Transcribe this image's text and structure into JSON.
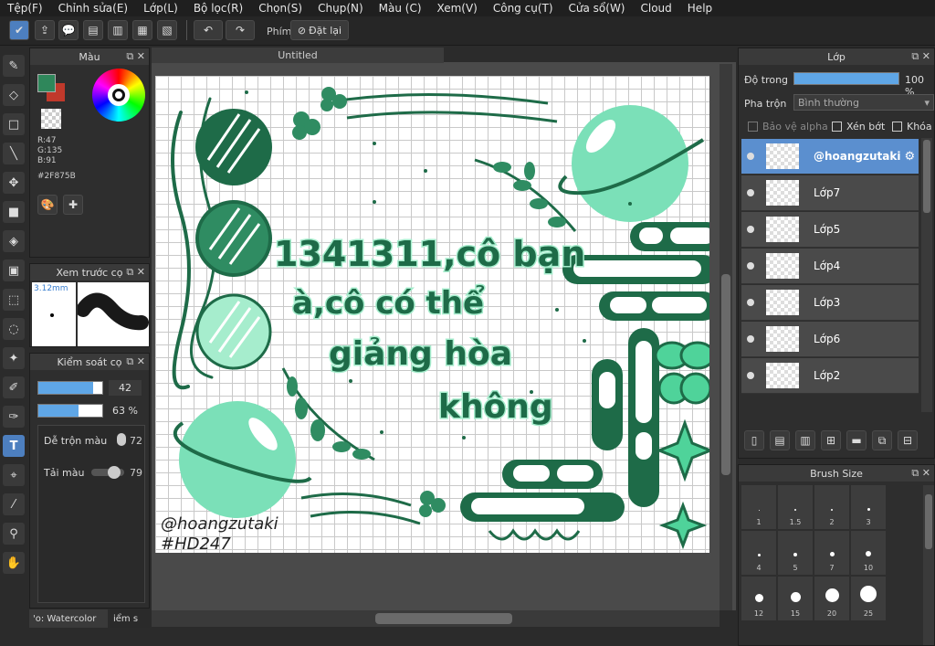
{
  "menu": [
    "Tệp(F)",
    "Chỉnh sửa(E)",
    "Lớp(L)",
    "Bộ lọc(R)",
    "Chọn(S)",
    "Chụp(N)",
    "Màu (C)",
    "Xem(V)",
    "Công cụ(T)",
    "Cửa sổ(W)",
    "Cloud",
    "Help"
  ],
  "toolbar": {
    "shortcut_label": "Phím",
    "reset_label": "Đặt lại"
  },
  "document": {
    "tab_title": "Untitled"
  },
  "color_panel": {
    "title": "Màu",
    "r": "R:47",
    "g": "G:135",
    "b": "B:91",
    "hex": "#2F875B",
    "primary_color": "#2F875B",
    "secondary_color": "#c0392b"
  },
  "brush_preview": {
    "title": "Xem trước cọ",
    "size": "3.12mm"
  },
  "brush_control": {
    "title": "Kiểm soát cọ",
    "size_value": "42",
    "opacity_value": "63 %",
    "size_level": 0.85,
    "opacity_level": 0.63,
    "blend_label": "Dễ trộn màu",
    "blend_value": "72",
    "load_label": "Tải màu",
    "load_value": "79"
  },
  "bottom_tabs": [
    "'o: Watercolor",
    "iểm s"
  ],
  "layers_panel": {
    "title": "Lớp",
    "opacity_label": "Độ trong",
    "opacity_value": "100 %",
    "blend_label": "Pha trộn",
    "blend_value": "Bình thường",
    "protect_alpha": "Bảo vệ alpha",
    "clipping": "Xén bớt",
    "lock": "Khóa",
    "layers": [
      {
        "name": "@hoangzutaki",
        "selected": true
      },
      {
        "name": "Lớp7",
        "selected": false
      },
      {
        "name": "Lớp5",
        "selected": false
      },
      {
        "name": "Lớp4",
        "selected": false
      },
      {
        "name": "Lớp3",
        "selected": false
      },
      {
        "name": "Lớp6",
        "selected": false
      },
      {
        "name": "Lớp2",
        "selected": false
      }
    ]
  },
  "brush_size_panel": {
    "title": "Brush Size",
    "sizes": [
      "1",
      "1.5",
      "2",
      "3",
      "4",
      "5",
      "7",
      "10",
      "12",
      "15",
      "20",
      "25"
    ]
  },
  "artwork": {
    "line1": "1341311,cô bạn",
    "line2": "à,cô có thể",
    "line3": "giảng hòa",
    "line4": "không",
    "signature": "@hoangzutaki",
    "hashtag": "#HD247",
    "primary_color": "#1e6b48",
    "mint_color": "#7be0b8"
  }
}
